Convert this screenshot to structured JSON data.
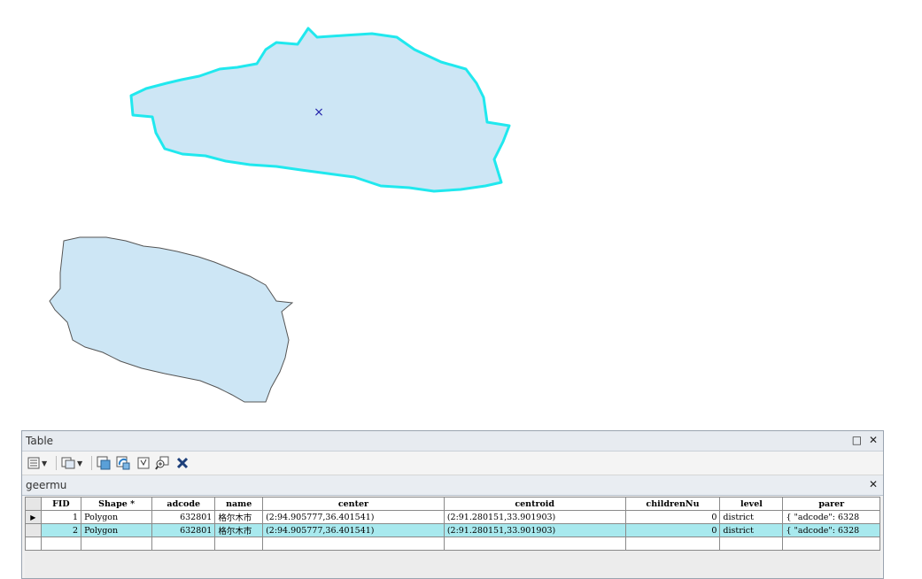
{
  "colors": {
    "polygon_fill": "#cde6f5",
    "selected_outline": "#20e8ee",
    "normal_outline": "#555555",
    "selected_row": "#a8e9ee"
  },
  "map": {
    "feature1_marker": "×"
  },
  "table_window": {
    "title": "Table",
    "restore_icon": "□",
    "close_icon": "✕"
  },
  "toolbar": {
    "icons": [
      "table-options-icon",
      "related-tables-icon",
      "select-by-attributes-icon",
      "switch-selection-icon",
      "clear-selection-icon",
      "zoom-to-selected-icon",
      "delete-selected-icon"
    ]
  },
  "tab": {
    "name": "geermu",
    "close_icon": "✕"
  },
  "grid": {
    "columns": [
      "FID",
      "Shape *",
      "adcode",
      "name",
      "center",
      "centroid",
      "childrenNu",
      "level",
      "parer"
    ],
    "rows": [
      {
        "selected": false,
        "FID": "1",
        "shape": "Polygon",
        "adcode": "632801",
        "name": "格尔木市",
        "center": "(2:94.905777,36.401541)",
        "centroid": "(2:91.280151,33.901903)",
        "childrenNu": "0",
        "level": "district",
        "parent": "{ \"adcode\": 6328"
      },
      {
        "selected": true,
        "FID": "2",
        "shape": "Polygon",
        "adcode": "632801",
        "name": "格尔木市",
        "center": "(2:94.905777,36.401541)",
        "centroid": "(2:91.280151,33.901903)",
        "childrenNu": "0",
        "level": "district",
        "parent": "{ \"adcode\": 6328"
      }
    ],
    "current_row_indicator": "▶"
  }
}
